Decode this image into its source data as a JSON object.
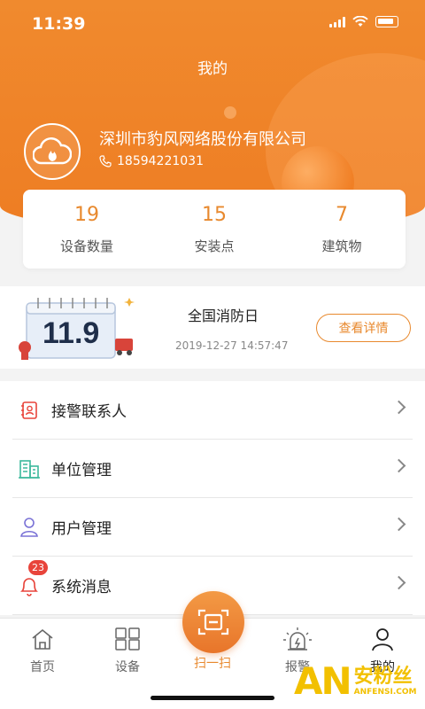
{
  "status_bar": {
    "time": "11:39"
  },
  "header": {
    "title": "我的"
  },
  "profile": {
    "company": "深圳市豹风网络股份有限公司",
    "phone": "18594221031"
  },
  "stats": [
    {
      "value": "19",
      "label": "设备数量"
    },
    {
      "value": "15",
      "label": "安装点"
    },
    {
      "value": "7",
      "label": "建筑物"
    }
  ],
  "event": {
    "calendar_number": "11.9",
    "title": "全国消防日",
    "time": "2019-12-27 14:57:47",
    "button": "查看详情"
  },
  "menu": [
    {
      "label": "接警联系人",
      "icon": "contact-book-icon"
    },
    {
      "label": "单位管理",
      "icon": "building-icon"
    },
    {
      "label": "用户管理",
      "icon": "user-icon"
    },
    {
      "label": "系统消息",
      "icon": "bell-icon",
      "badge": "23"
    }
  ],
  "tabs": [
    {
      "label": "首页",
      "icon": "home-icon"
    },
    {
      "label": "设备",
      "icon": "devices-icon"
    },
    {
      "label": "扫一扫",
      "icon": "scan-icon"
    },
    {
      "label": "报警",
      "icon": "alarm-icon"
    },
    {
      "label": "我的",
      "icon": "profile-icon"
    }
  ],
  "watermark": {
    "big": "AN",
    "cn": "安粉丝",
    "en": "ANFENSI.COM"
  },
  "colors": {
    "accent": "#e8892e",
    "header": "#ef8228",
    "badge": "#e8443b"
  }
}
